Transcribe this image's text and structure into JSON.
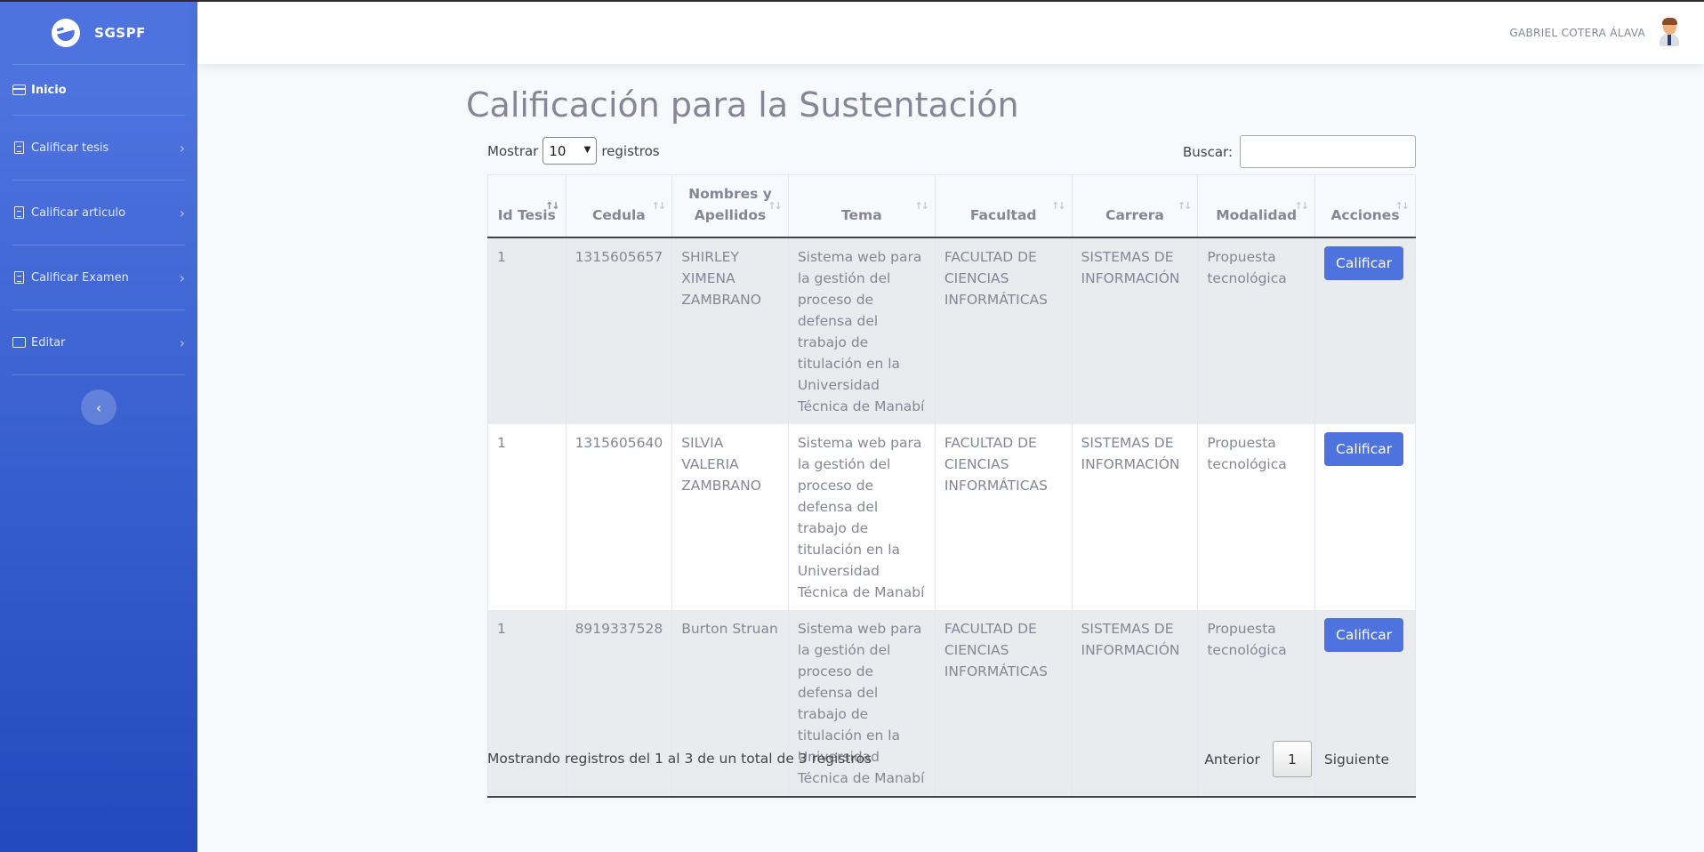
{
  "brand": {
    "name": "SGSPF"
  },
  "sidebar": {
    "items": [
      {
        "label": "Inicio"
      },
      {
        "label": "Calificar tesis"
      },
      {
        "label": "Calificar articulo"
      },
      {
        "label": "Calificar Examen"
      },
      {
        "label": "Editar"
      }
    ],
    "collapse_glyph": "‹",
    "chevron_glyph": "›"
  },
  "topbar": {
    "user_name": "GABRIEL COTERA ÁLAVA"
  },
  "page": {
    "title": "Calificación para la Sustentación"
  },
  "table_controls": {
    "show_label": "Mostrar",
    "length_value": "10",
    "records_label": "registros",
    "search_label": "Buscar:",
    "search_value": ""
  },
  "table": {
    "headers": [
      "Id Tesis",
      "Cedula",
      "Nombres y Apellidos",
      "Tema",
      "Facultad",
      "Carrera",
      "Modalidad",
      "Acciones"
    ],
    "rows": [
      {
        "id": "1",
        "cedula": "1315605657",
        "nombres": "SHIRLEY XIMENA ZAMBRANO",
        "tema": "Sistema web para la gestión del proceso de defensa del trabajo de titulación en la Universidad Técnica de Manabí",
        "facultad": "FACULTAD DE CIENCIAS INFORMÁTICAS",
        "carrera": "SISTEMAS DE INFORMACIÓN",
        "modalidad": "Propuesta tecnológica",
        "action": "Calificar"
      },
      {
        "id": "1",
        "cedula": "1315605640",
        "nombres": "SILVIA VALERIA ZAMBRANO",
        "tema": "Sistema web para la gestión del proceso de defensa del trabajo de titulación en la Universidad Técnica de Manabí",
        "facultad": "FACULTAD DE CIENCIAS INFORMÁTICAS",
        "carrera": "SISTEMAS DE INFORMACIÓN",
        "modalidad": "Propuesta tecnológica",
        "action": "Calificar"
      },
      {
        "id": "1",
        "cedula": "8919337528",
        "nombres": "Burton Struan",
        "tema": "Sistema web para la gestión del proceso de defensa del trabajo de titulación en la Universidad Técnica de Manabí",
        "facultad": "FACULTAD DE CIENCIAS INFORMÁTICAS",
        "carrera": "SISTEMAS DE INFORMACIÓN",
        "modalidad": "Propuesta tecnológica",
        "action": "Calificar"
      }
    ]
  },
  "footer": {
    "info": "Mostrando registros del 1 al 3 de un total de 3 registros",
    "prev": "Anterior",
    "page": "1",
    "next": "Siguiente"
  },
  "colors": {
    "primary": "#4e73df",
    "primary_dark": "#224abe",
    "text_muted": "#858796"
  }
}
